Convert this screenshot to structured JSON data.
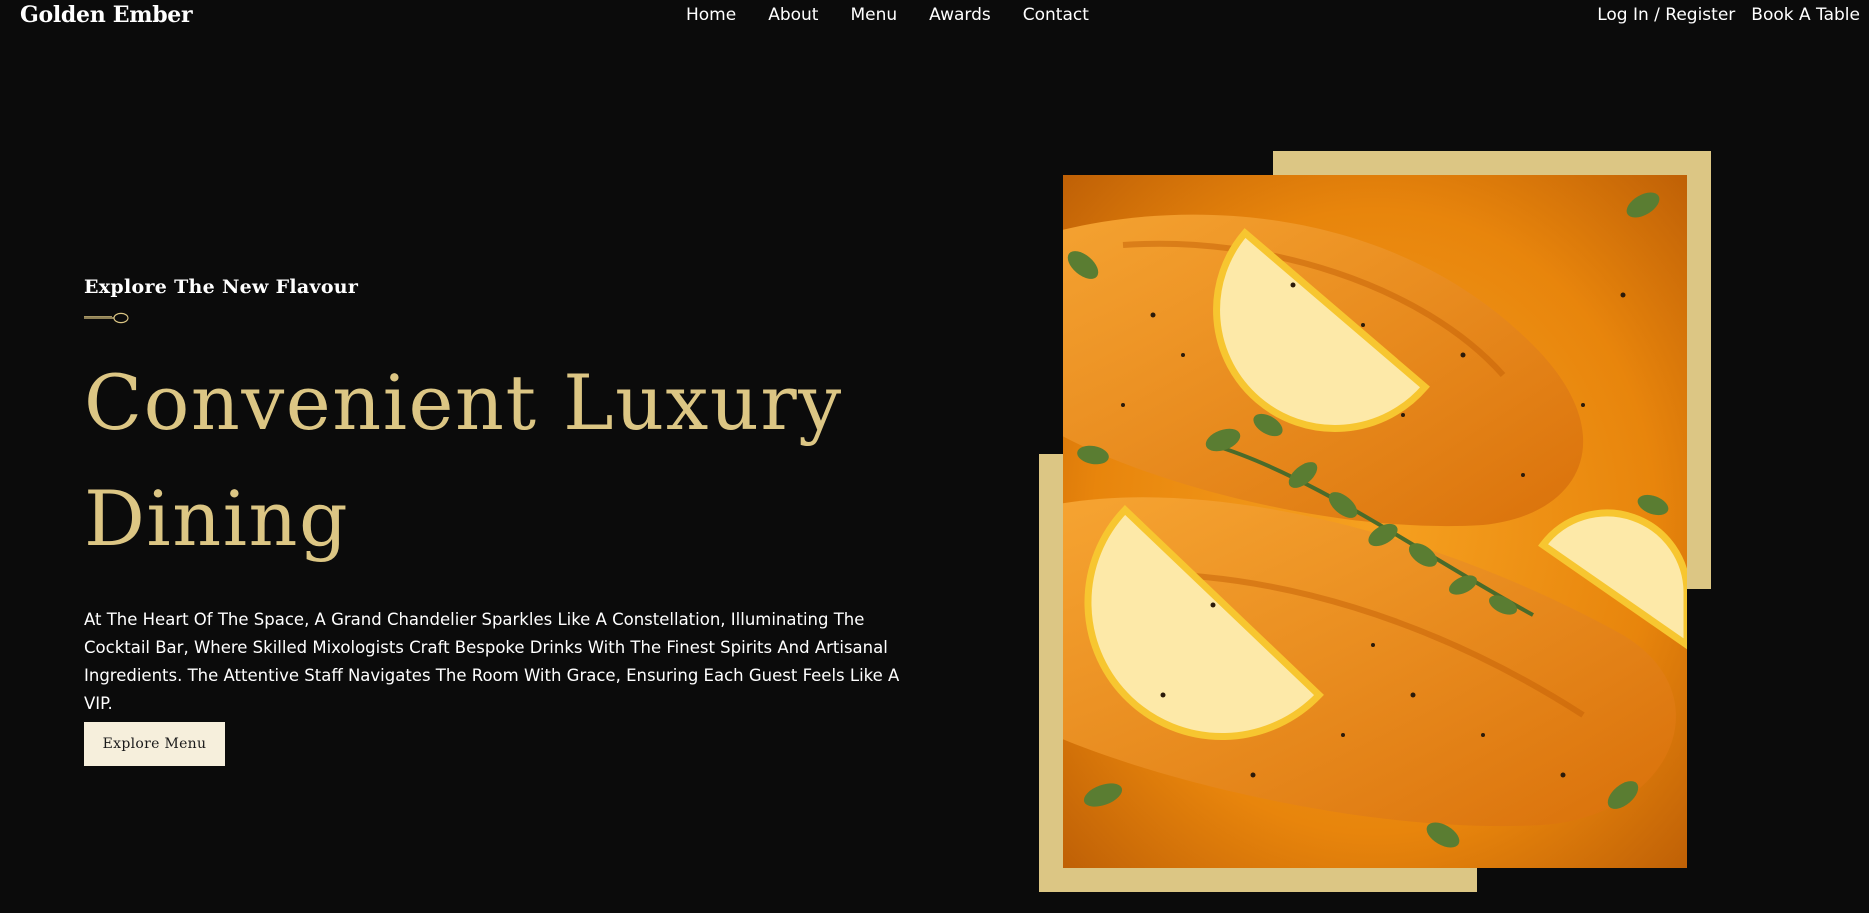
{
  "brand": {
    "name": "Golden Ember"
  },
  "nav": {
    "links": [
      "Home",
      "About",
      "Menu",
      "Awards",
      "Contact"
    ],
    "login_label": "Log In / Register",
    "book_label": "Book A Table"
  },
  "hero": {
    "eyebrow": "Explore The New Flavour",
    "title_line1": "Convenient Luxury",
    "title_line2": "Dining",
    "description": "At The Heart Of The Space, A Grand Chandelier Sparkles Like A Constellation, Illuminating The Cocktail Bar, Where Skilled Mixologists Craft Bespoke Drinks With The Finest Spirits And Artisanal Ingredients. The Attentive Staff Navigates The Room With Grace, Ensuring Each Guest Feels Like A VIP.",
    "cta_label": "Explore Menu"
  },
  "colors": {
    "background": "#0b0b0b",
    "accent_gold": "#dcc684",
    "button_bg": "#f6efdc",
    "text": "#ffffff"
  },
  "icons": {
    "divider": "spoon-icon"
  }
}
